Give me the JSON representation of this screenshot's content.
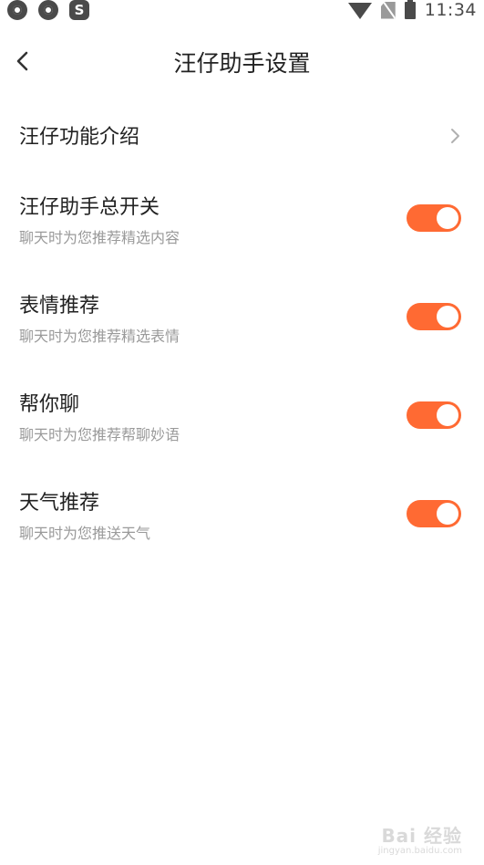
{
  "status_bar": {
    "app_icons": [
      "app-icon-1",
      "app-icon-2",
      "sogou-icon"
    ],
    "sogou_letter": "S",
    "time": "11:34"
  },
  "header": {
    "back_icon": "back-arrow-icon",
    "title": "汪仔助手设置"
  },
  "intro": {
    "label": "汪仔功能介绍",
    "chevron_icon": "chevron-right-icon"
  },
  "settings": [
    {
      "title": "汪仔助手总开关",
      "subtitle": "聊天时为您推荐精选内容",
      "enabled": true
    },
    {
      "title": "表情推荐",
      "subtitle": "聊天时为您推荐精选表情",
      "enabled": true
    },
    {
      "title": "帮你聊",
      "subtitle": "聊天时为您推荐帮聊妙语",
      "enabled": true
    },
    {
      "title": "天气推荐",
      "subtitle": "聊天时为您推送天气",
      "enabled": true
    }
  ],
  "colors": {
    "accent": "#ff6a33",
    "subtitle": "#9a9a9a",
    "text": "#222222"
  },
  "watermark": {
    "main": "Bai 经验",
    "sub": "jingyan.baidu.com"
  }
}
